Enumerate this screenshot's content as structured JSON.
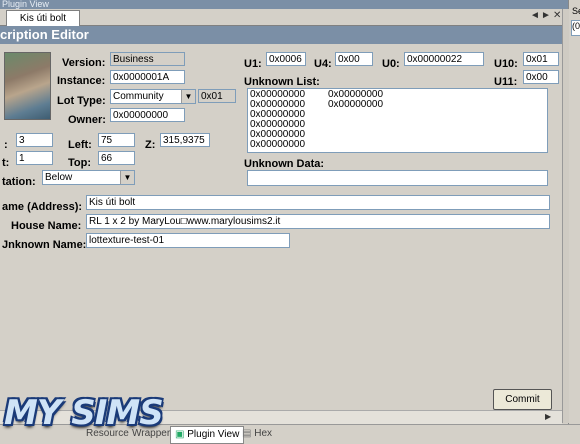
{
  "window": {
    "title": "Plugin View",
    "side_title": "Se",
    "side_value": "(0"
  },
  "tab": {
    "label": "Kis úti bolt",
    "controls": [
      "◄",
      "►",
      "✕"
    ]
  },
  "editor": {
    "title": "cription Editor"
  },
  "fields": {
    "version": {
      "label": "Version:",
      "value": "Business"
    },
    "instance": {
      "label": "Instance:",
      "value": "0x0000001A"
    },
    "lot_type": {
      "label": "Lot Type:",
      "value": "Community",
      "code": "0x01"
    },
    "owner": {
      "label": "Owner:",
      "value": "0x00000000"
    },
    "width_val": "3",
    "width_label": ":",
    "height_val": "1",
    "height_label": "t:",
    "left": {
      "label": "Left:",
      "value": "75"
    },
    "top": {
      "label": "Top:",
      "value": "66"
    },
    "z": {
      "label": "Z:",
      "value": "315,9375"
    },
    "rotation": {
      "label": "tation:",
      "value": "Below"
    },
    "u1": {
      "label": "U1:",
      "value": "0x0006"
    },
    "u4": {
      "label": "U4:",
      "value": "0x00"
    },
    "u0": {
      "label": "U0:",
      "value": "0x00000022"
    },
    "u10": {
      "label": "U10:",
      "value": "0x01"
    },
    "u11": {
      "label": "U11:",
      "value": "0x00"
    },
    "unknown_list": {
      "label": "Unknown List:",
      "col1": [
        "0x00000000",
        "0x00000000",
        "0x00000000",
        "0x00000000",
        "0x00000000",
        "0x00000000",
        "0x00000000"
      ],
      "col2": [
        "0x00000000",
        "0x00000000"
      ]
    },
    "unknown_data": {
      "label": "Unknown Data:",
      "value": ""
    },
    "name": {
      "label": "ame (Address):",
      "value": "Kis úti bolt"
    },
    "house_name": {
      "label": "House Name:",
      "value": "RL 1 x 2  by MaryLou□www.marylousims2.it"
    },
    "unknown_name": {
      "label": "Jnknown Name:",
      "value": "lottexture-test-01"
    }
  },
  "buttons": {
    "commit": "Commit"
  },
  "bottom_tabs": [
    {
      "label": "Resource",
      "active": false
    },
    {
      "label": "Wrapper",
      "active": false
    },
    {
      "label": "Plugin View",
      "active": true
    },
    {
      "label": "Hex",
      "active": false
    }
  ],
  "logo": {
    "text": "MY SIMS"
  }
}
